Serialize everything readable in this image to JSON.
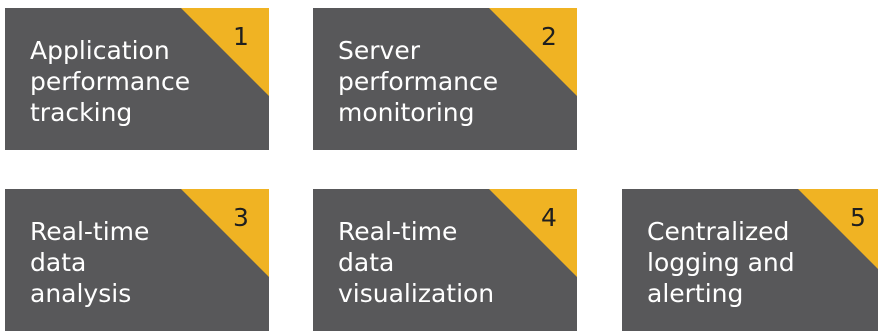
{
  "cards": [
    {
      "number": "1",
      "label": "Application\nperformance\ntracking"
    },
    {
      "number": "2",
      "label": "Server\nperformance\nmonitoring"
    },
    {
      "number": "3",
      "label": "Real-time\ndata analysis"
    },
    {
      "number": "4",
      "label": "Real-time\ndata visualization"
    },
    {
      "number": "5",
      "label": "Centralized\nlogging and\nalerting"
    }
  ],
  "colors": {
    "card_background": "#58585a",
    "corner_accent": "#f0b323",
    "label_text": "#ffffff",
    "number_text": "#1f1f1f"
  }
}
